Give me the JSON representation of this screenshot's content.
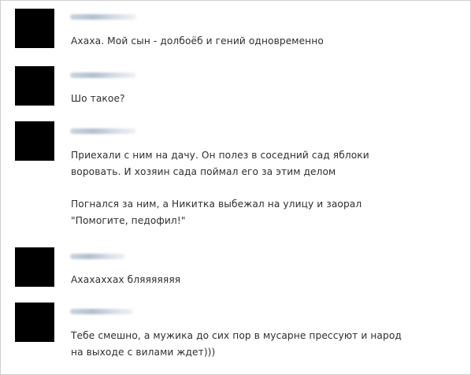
{
  "messages": [
    {
      "lines": [
        "Ахаха. Мой сын - долбоёб и гений одновременно"
      ]
    },
    {
      "lines": [
        "Шо такое?"
      ]
    },
    {
      "lines": [
        "Приехали с ним на дачу. Он полез в соседний сад яблоки",
        "воровать. И хозяин сада поймал его за этим делом"
      ],
      "lines2": [
        "Погнался за ним, а Никитка выбежал на улицу и заорал",
        "\"Помогите, педофил!\""
      ]
    },
    {
      "lines": [
        "Ахахаххах бляяяяяяя"
      ]
    },
    {
      "lines": [
        "Тебе смешно, а мужика до сих пор в мусарне прессуют и народ",
        "на выходе с вилами ждет)))"
      ]
    }
  ],
  "colors": {
    "avatar": "#000000",
    "text": "#2e2e2e",
    "author_blur": "#aebccb"
  }
}
